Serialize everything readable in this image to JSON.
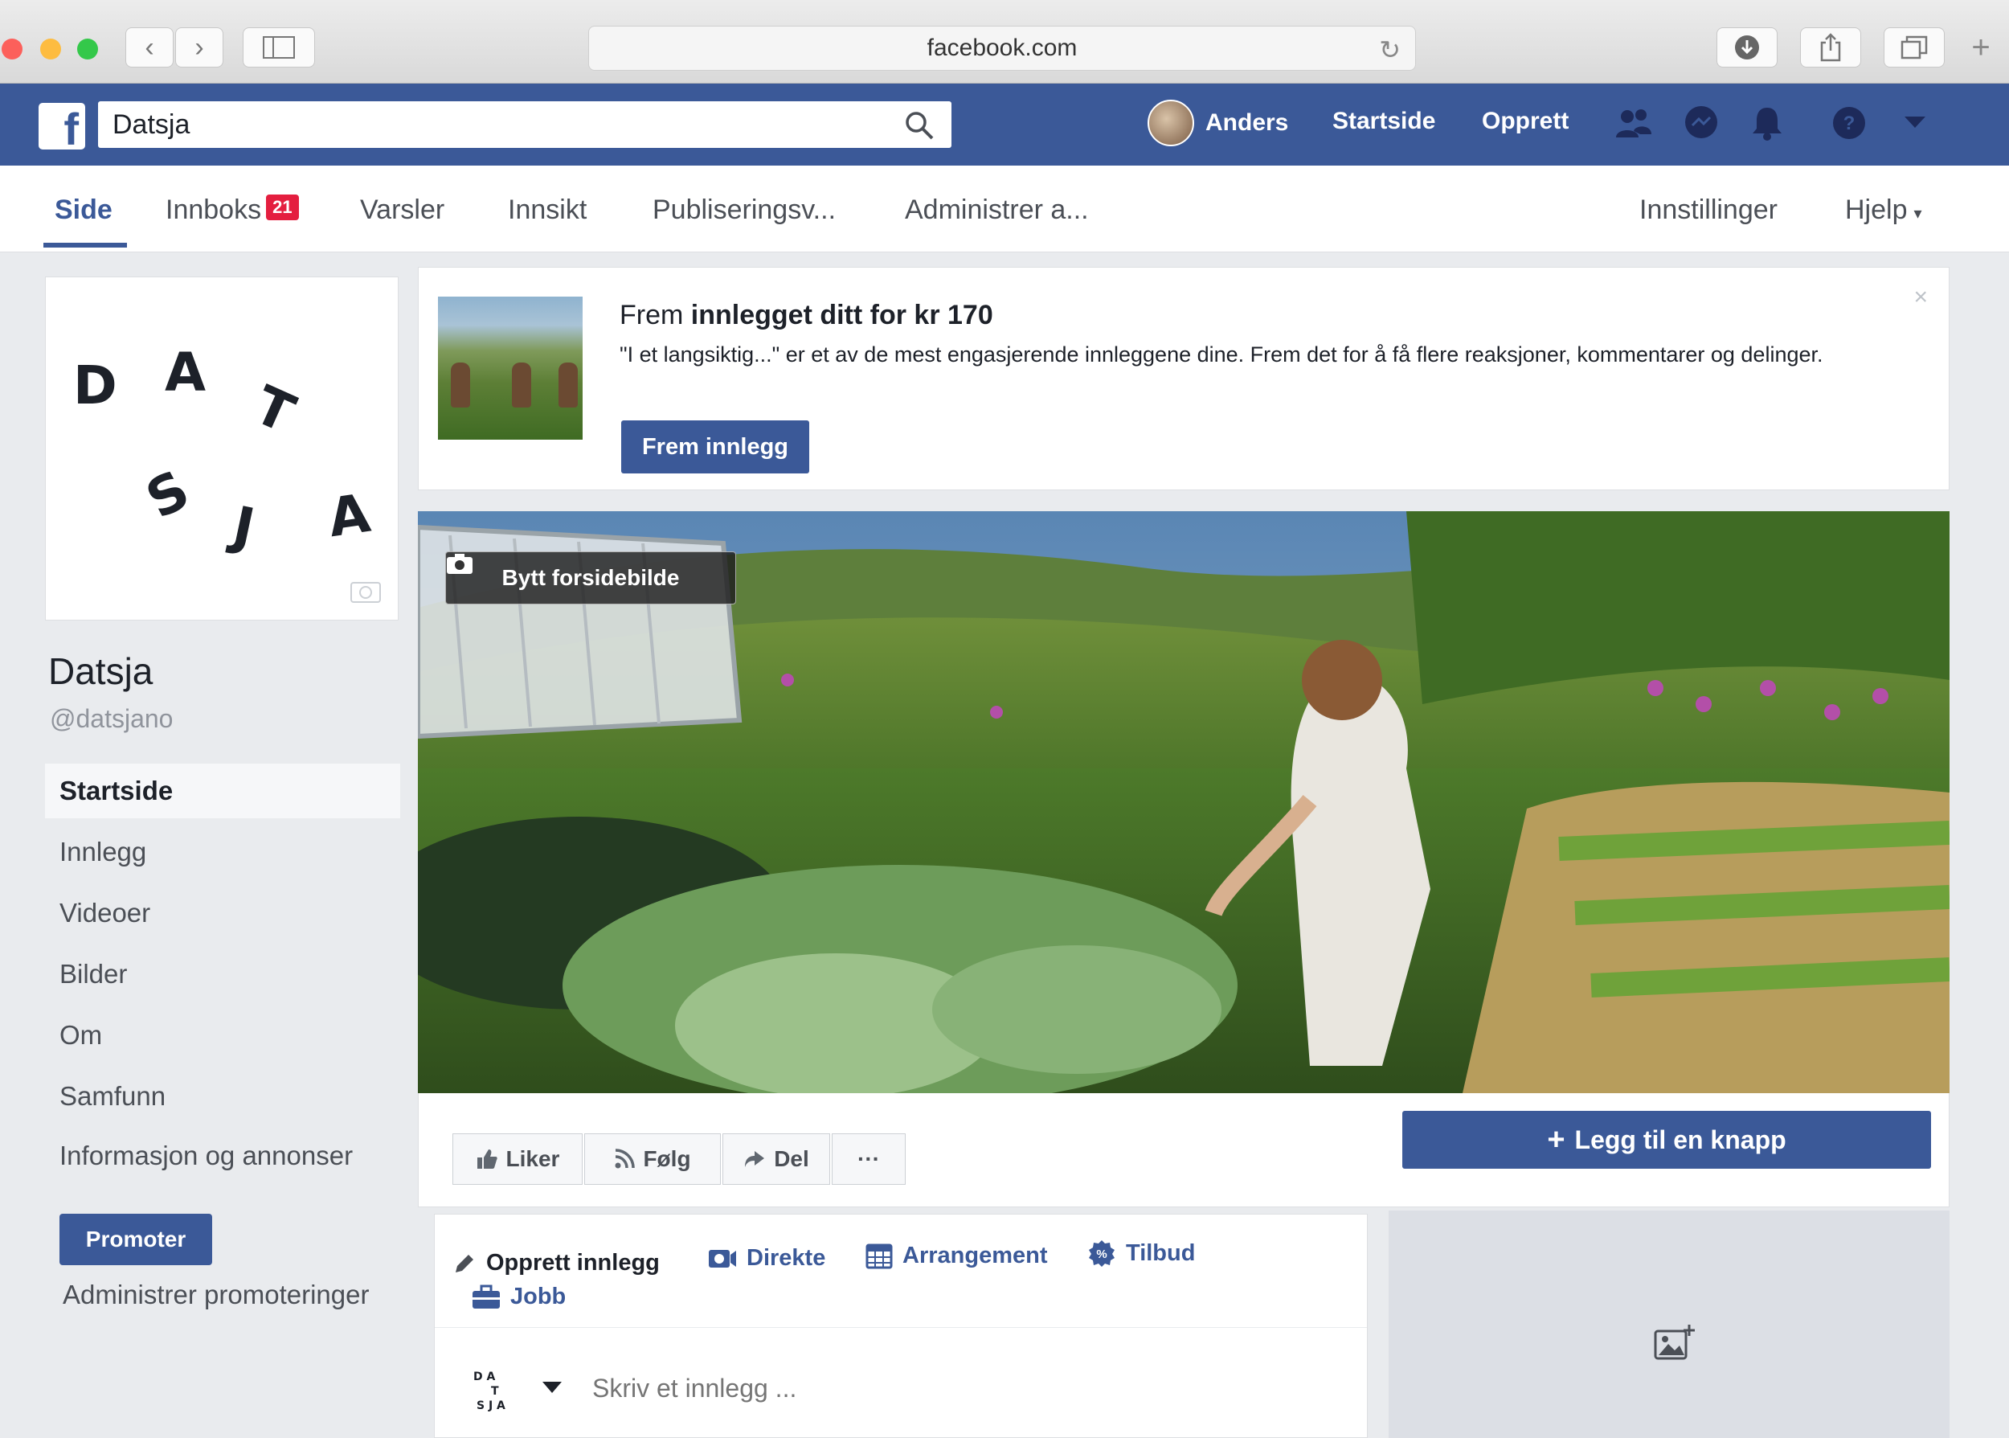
{
  "browser": {
    "url": "facebook.com",
    "icons": [
      "back-icon",
      "forward-icon",
      "sidebar-icon",
      "reload-icon",
      "download-icon",
      "share-icon",
      "tabs-icon",
      "new-tab-icon"
    ]
  },
  "topbar": {
    "search_value": "Datsja",
    "user_name": "Anders",
    "home_label": "Startside",
    "create_label": "Opprett",
    "brand_color": "#3b5998"
  },
  "pagenav": {
    "items": [
      "Side",
      "Innboks",
      "Varsler",
      "Innsikt",
      "Publiseringsv...",
      "Administrer a..."
    ],
    "inbox_badge": "21",
    "settings_label": "Innstillinger",
    "help_label": "Hjelp"
  },
  "profile": {
    "logo_letters": [
      "D",
      "A",
      "T",
      "S",
      "J",
      "A"
    ],
    "name": "Datsja",
    "handle": "@datsjano"
  },
  "leftnav": {
    "items": [
      "Startside",
      "Innlegg",
      "Videoer",
      "Bilder",
      "Om",
      "Samfunn",
      "Informasjon og annonser"
    ],
    "promote_label": "Promoter",
    "manage_promotions_label": "Administrer promoteringer"
  },
  "promo": {
    "title_prefix": "Frem ",
    "title_bold": "innlegget ditt for kr 170",
    "text": "\"I et langsiktig...\" er et av de mest engasjerende innleggene dine. Frem det for å få flere reaksjoner, kommentarer og delinger.",
    "button_label": "Frem innlegg",
    "close_label": "×"
  },
  "cover": {
    "change_cover_label": "Bytt forsidebilde"
  },
  "actions": {
    "like_label": "Liker",
    "follow_label": "Følg",
    "share_label": "Del",
    "more_label": "···",
    "cta_label": "Legg til en knapp"
  },
  "composer": {
    "create_post_label": "Opprett innlegg",
    "live_label": "Direkte",
    "event_label": "Arrangement",
    "offer_label": "Tilbud",
    "job_label": "Jobb",
    "placeholder": "Skriv et innlegg ..."
  }
}
